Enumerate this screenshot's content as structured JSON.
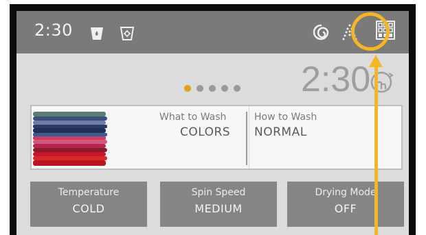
{
  "status_bar": {
    "time": "2:30",
    "icons": [
      "detergent-icon",
      "softener-icon",
      "spin-icon",
      "rinse-icon",
      "grid-menu-icon"
    ]
  },
  "page_indicator": {
    "count": 5,
    "active_index": 0
  },
  "countdown": {
    "time": "2:30",
    "icon": "hour-delay-icon"
  },
  "cycle": {
    "what_to_wash_label": "What to Wash",
    "what_to_wash_value": "COLORS",
    "how_to_wash_label": "How to Wash",
    "how_to_wash_value": "NORMAL"
  },
  "options": [
    {
      "label": "Temperature",
      "value": "COLD"
    },
    {
      "label": "Spin Speed",
      "value": "MEDIUM"
    },
    {
      "label": "Drying Mode",
      "value": "OFF"
    }
  ],
  "colors": {
    "highlight": "#f4b626",
    "active_dot": "#e0a020",
    "status_bar": "#7a7a7a",
    "tile": "#858585"
  }
}
